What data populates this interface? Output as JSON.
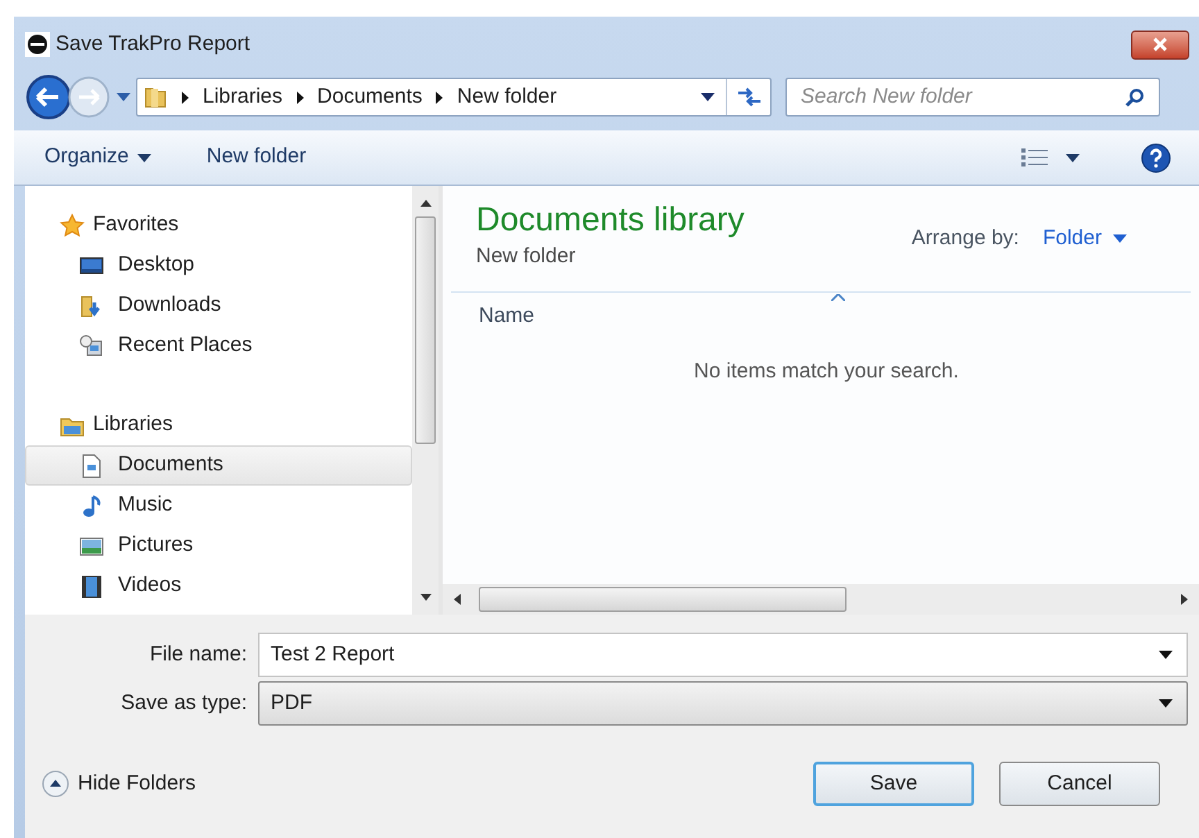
{
  "window": {
    "title": "Save TrakPro Report"
  },
  "breadcrumb": [
    "Libraries",
    "Documents",
    "New folder"
  ],
  "search": {
    "placeholder": "Search New folder"
  },
  "toolbar": {
    "organize": "Organize",
    "new_folder": "New folder"
  },
  "navigation": [
    {
      "label": "Favorites",
      "selected": false,
      "children": [
        {
          "label": "Desktop",
          "selected": false
        },
        {
          "label": "Downloads",
          "selected": false
        },
        {
          "label": "Recent Places",
          "selected": false
        }
      ]
    },
    {
      "label": "Libraries",
      "selected": false,
      "children": [
        {
          "label": "Documents",
          "selected": true
        },
        {
          "label": "Music",
          "selected": false
        },
        {
          "label": "Pictures",
          "selected": false
        },
        {
          "label": "Videos",
          "selected": false
        }
      ]
    }
  ],
  "library": {
    "title": "Documents library",
    "subtitle": "New folder",
    "arrange_label": "Arrange by:",
    "arrange_value": "Folder"
  },
  "columns": [
    "Name"
  ],
  "empty_message": "No items match your search.",
  "form": {
    "file_name_label": "File name:",
    "file_name": "Test 2 Report",
    "type_label": "Save as type:",
    "type": "PDF"
  },
  "hide_folders": "Hide Folders",
  "buttons": [
    {
      "label": "Save",
      "default": true
    },
    {
      "label": "Cancel",
      "default": false
    }
  ]
}
